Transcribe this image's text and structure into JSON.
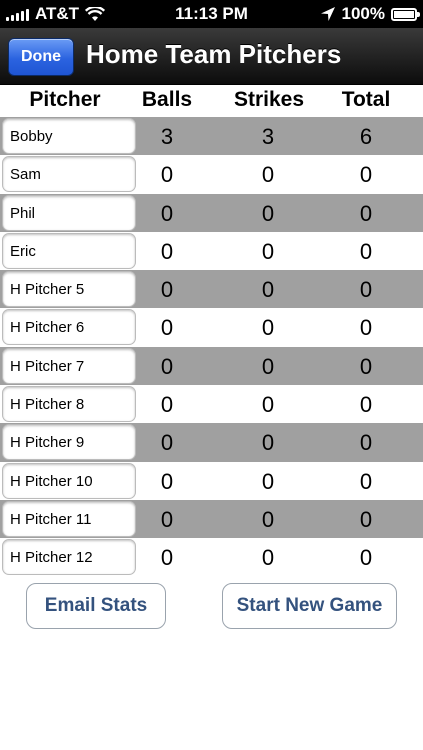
{
  "status_bar": {
    "carrier": "AT&T",
    "time": "11:13 PM",
    "battery": "100%",
    "icons": [
      "signal-bars-icon",
      "wifi-icon",
      "location-arrow-icon",
      "battery-icon"
    ]
  },
  "nav": {
    "done_label": "Done",
    "title": "Home Team Pitchers"
  },
  "table": {
    "headers": {
      "pitcher": "Pitcher",
      "balls": "Balls",
      "strikes": "Strikes",
      "total": "Total"
    },
    "rows": [
      {
        "name": "Bobby",
        "balls": "3",
        "strikes": "3",
        "total": "6"
      },
      {
        "name": "Sam",
        "balls": "0",
        "strikes": "0",
        "total": "0"
      },
      {
        "name": "Phil",
        "balls": "0",
        "strikes": "0",
        "total": "0"
      },
      {
        "name": "Eric",
        "balls": "0",
        "strikes": "0",
        "total": "0"
      },
      {
        "name": "H Pitcher 5",
        "balls": "0",
        "strikes": "0",
        "total": "0"
      },
      {
        "name": "H Pitcher 6",
        "balls": "0",
        "strikes": "0",
        "total": "0"
      },
      {
        "name": "H Pitcher 7",
        "balls": "0",
        "strikes": "0",
        "total": "0"
      },
      {
        "name": "H Pitcher 8",
        "balls": "0",
        "strikes": "0",
        "total": "0"
      },
      {
        "name": "H Pitcher 9",
        "balls": "0",
        "strikes": "0",
        "total": "0"
      },
      {
        "name": "H Pitcher 10",
        "balls": "0",
        "strikes": "0",
        "total": "0"
      },
      {
        "name": "H Pitcher 11",
        "balls": "0",
        "strikes": "0",
        "total": "0"
      },
      {
        "name": "H Pitcher 12",
        "balls": "0",
        "strikes": "0",
        "total": "0"
      }
    ]
  },
  "actions": {
    "email_label": "Email Stats",
    "new_game_label": "Start New Game"
  },
  "colors": {
    "shaded_row": "#a0a0a0",
    "button_text": "#34527e",
    "done_button": "#2b63e0"
  }
}
